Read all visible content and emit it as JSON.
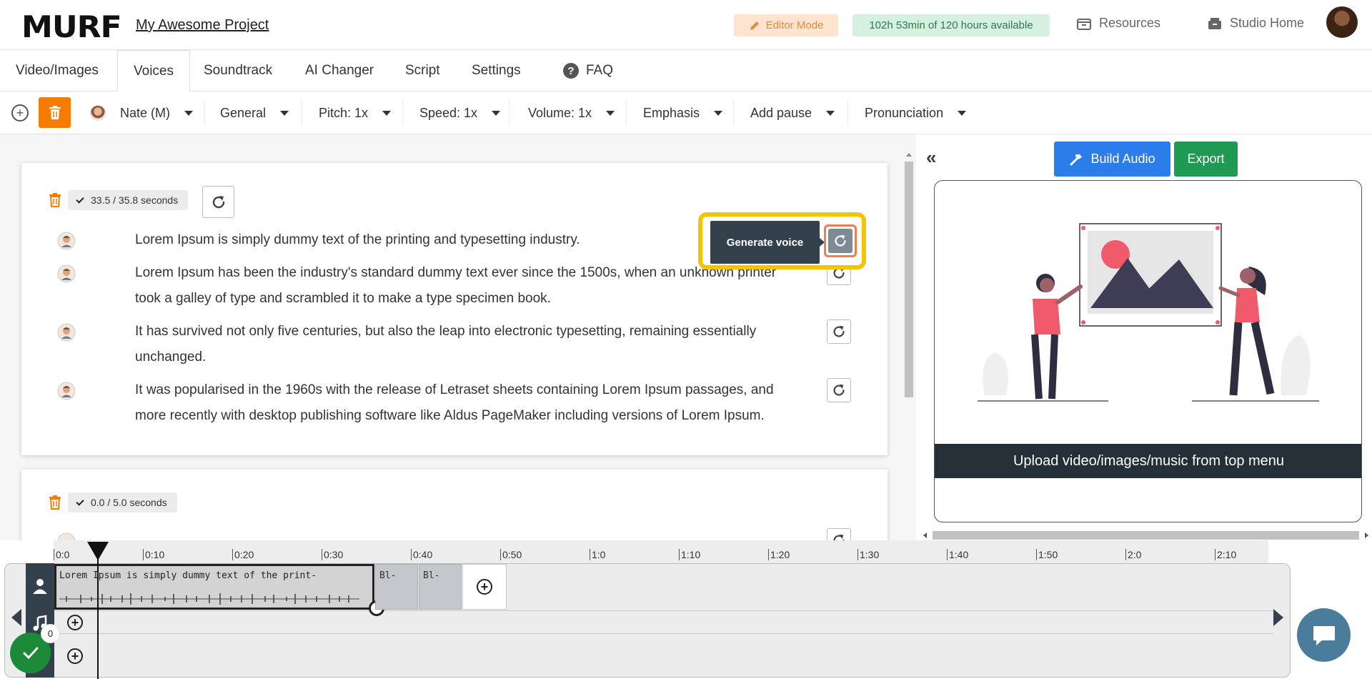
{
  "header": {
    "logo": "MURF",
    "project_name": "My Awesome Project",
    "editor_mode": "Editor Mode",
    "hours_available": "102h 53min of 120 hours available",
    "resources": "Resources",
    "studio_home": "Studio Home"
  },
  "tabs": [
    {
      "label": "Video/Images"
    },
    {
      "label": "Voices"
    },
    {
      "label": "Soundtrack"
    },
    {
      "label": "AI Changer"
    },
    {
      "label": "Script"
    },
    {
      "label": "Settings"
    },
    {
      "label": "FAQ"
    }
  ],
  "toolbar": {
    "voice": "Nate (M)",
    "style": "General",
    "pitch": "Pitch: 1x",
    "speed": "Speed: 1x",
    "volume": "Volume: 1x",
    "emphasis": "Emphasis",
    "add_pause": "Add pause",
    "pronunciation": "Pronunciation"
  },
  "blocks": [
    {
      "duration": "33.5 / 35.8 seconds",
      "lines": [
        {
          "text": "Lorem Ipsum is simply dummy text of the printing and typesetting industry."
        },
        {
          "text": "Lorem Ipsum has been the industry's standard dummy text ever since the 1500s, when an unknown printer took a galley of type and scrambled it to make a type specimen book."
        },
        {
          "text": "It has survived not only five centuries, but also the leap into electronic typesetting, remaining essentially unchanged."
        },
        {
          "text": "It was popularised in the 1960s with the release of Letraset sheets containing Lorem Ipsum passages, and more recently with desktop publishing software like Aldus PageMaker including versions of Lorem Ipsum."
        }
      ]
    },
    {
      "duration": "0.0 / 5.0 seconds",
      "lines": []
    }
  ],
  "tooltip": {
    "label": "Generate voice"
  },
  "preview": {
    "build_audio": "Build Audio",
    "export": "Export",
    "upload_hint": "Upload video/images/music from top menu"
  },
  "timeline": {
    "ticks": [
      "0:0",
      "0:10",
      "0:20",
      "0:30",
      "0:40",
      "0:50",
      "1:0",
      "1:10",
      "1:20",
      "1:30",
      "1:40",
      "1:50",
      "2:0",
      "2:10"
    ],
    "main_clip_text": "Lorem Ipsum is simply dummy text of the print-",
    "clip_2_text": "Bl-",
    "clip_3_text": "Bl-",
    "status_count": "0"
  },
  "colors": {
    "accent_orange": "#f57c00",
    "build_blue": "#2b7de9",
    "export_green": "#1f9a52",
    "highlight_yellow": "#f5c400",
    "dark_slate": "#34404c"
  }
}
